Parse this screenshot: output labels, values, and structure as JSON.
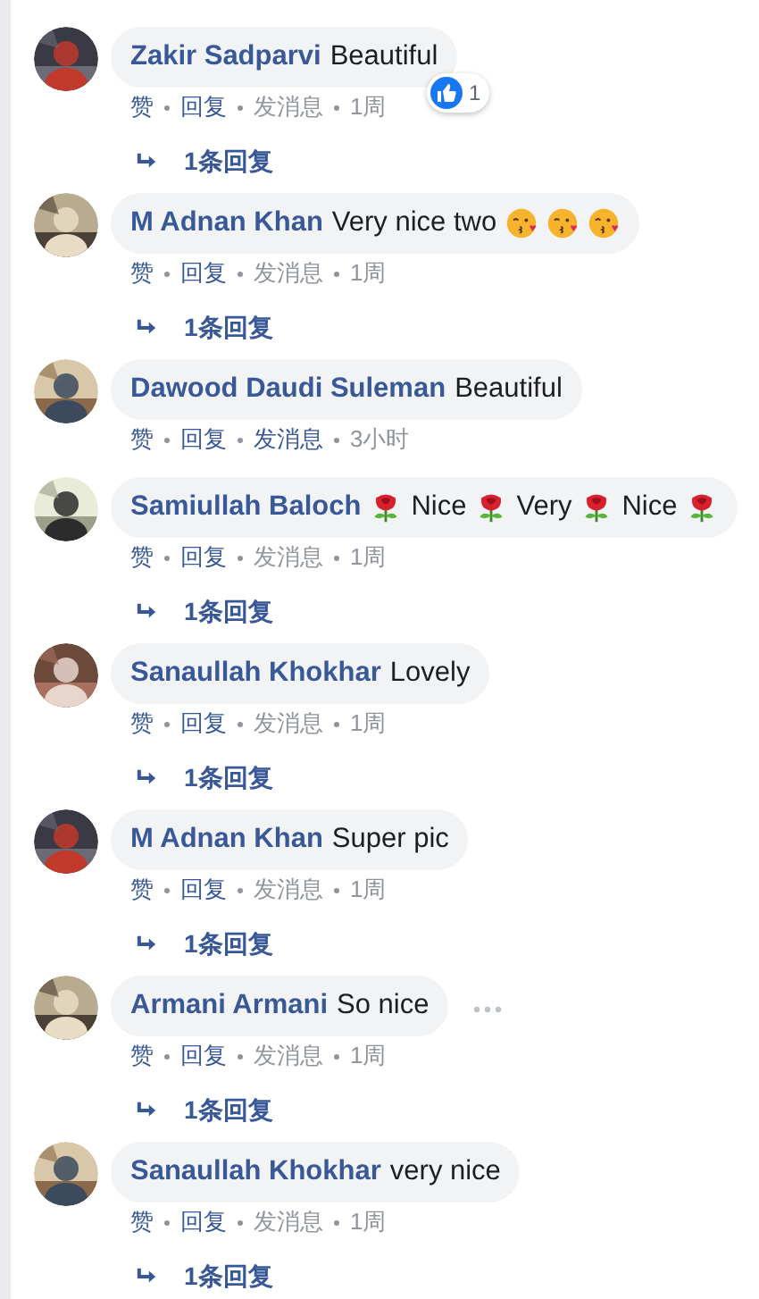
{
  "comments": [
    {
      "avatar": {
        "kind": "picture"
      },
      "author": "Zakir Sadparvi",
      "parts": [
        {
          "kind": "text",
          "text": "Beautiful"
        }
      ],
      "reaction": {
        "count": "1"
      },
      "more_button": false,
      "actions": [
        {
          "label": "赞",
          "kind": "link"
        },
        {
          "label": "回复",
          "kind": "link"
        },
        {
          "label": "发消息",
          "kind": "info"
        },
        {
          "label": "1周",
          "kind": "info"
        }
      ],
      "replies": "1条回复"
    },
    {
      "avatar": {
        "kind": "picture"
      },
      "author": "M Adnan Khan",
      "parts": [
        {
          "kind": "text",
          "text": "Very nice two"
        },
        {
          "kind": "kiss"
        },
        {
          "kind": "kiss"
        },
        {
          "kind": "kiss"
        }
      ],
      "more_button": false,
      "actions": [
        {
          "label": "赞",
          "kind": "link"
        },
        {
          "label": "回复",
          "kind": "link"
        },
        {
          "label": "发消息",
          "kind": "info"
        },
        {
          "label": "1周",
          "kind": "info"
        }
      ],
      "replies": "1条回复"
    },
    {
      "avatar": {
        "kind": "picture"
      },
      "author": "Dawood Daudi Suleman",
      "parts": [
        {
          "kind": "text",
          "text": "Beautiful"
        }
      ],
      "more_button": false,
      "actions": [
        {
          "label": "赞",
          "kind": "link"
        },
        {
          "label": "回复",
          "kind": "link"
        },
        {
          "label": "发消息",
          "kind": "link"
        },
        {
          "label": "3小时",
          "kind": "info"
        }
      ]
    },
    {
      "avatar": {
        "kind": "picture"
      },
      "author": "Samiullah Baloch",
      "parts": [
        {
          "kind": "rose"
        },
        {
          "kind": "text",
          "text": "Nice"
        },
        {
          "kind": "rose"
        },
        {
          "kind": "text",
          "text": "Very"
        },
        {
          "kind": "rose"
        },
        {
          "kind": "text",
          "text": "Nice"
        },
        {
          "kind": "rose"
        }
      ],
      "more_button": false,
      "actions": [
        {
          "label": "赞",
          "kind": "link"
        },
        {
          "label": "回复",
          "kind": "link"
        },
        {
          "label": "发消息",
          "kind": "info"
        },
        {
          "label": "1周",
          "kind": "info"
        }
      ],
      "replies": "1条回复"
    },
    {
      "avatar": {
        "kind": "picture"
      },
      "author": "Sanaullah Khokhar",
      "parts": [
        {
          "kind": "text",
          "text": "Lovely"
        }
      ],
      "more_button": false,
      "actions": [
        {
          "label": "赞",
          "kind": "link"
        },
        {
          "label": "回复",
          "kind": "link"
        },
        {
          "label": "发消息",
          "kind": "info"
        },
        {
          "label": "1周",
          "kind": "info"
        }
      ],
      "replies": "1条回复"
    },
    {
      "avatar": {
        "kind": "picture"
      },
      "author": "M Adnan Khan",
      "parts": [
        {
          "kind": "text",
          "text": "Super pic"
        }
      ],
      "more_button": false,
      "actions": [
        {
          "label": "赞",
          "kind": "link"
        },
        {
          "label": "回复",
          "kind": "link"
        },
        {
          "label": "发消息",
          "kind": "info"
        },
        {
          "label": "1周",
          "kind": "info"
        }
      ],
      "replies": "1条回复"
    },
    {
      "avatar": {
        "kind": "picture"
      },
      "author": "Armani Armani",
      "parts": [
        {
          "kind": "text",
          "text": "So nice"
        }
      ],
      "more_button": true,
      "actions": [
        {
          "label": "赞",
          "kind": "link"
        },
        {
          "label": "回复",
          "kind": "link"
        },
        {
          "label": "发消息",
          "kind": "info"
        },
        {
          "label": "1周",
          "kind": "info"
        }
      ],
      "replies": "1条回复"
    },
    {
      "avatar": {
        "kind": "picture"
      },
      "author": "Sanaullah Khokhar",
      "parts": [
        {
          "kind": "text",
          "text": "very nice"
        }
      ],
      "more_button": false,
      "actions": [
        {
          "label": "赞",
          "kind": "link"
        },
        {
          "label": "回复",
          "kind": "link"
        },
        {
          "label": "发消息",
          "kind": "info"
        },
        {
          "label": "1周",
          "kind": "info"
        }
      ],
      "replies": "1条回复"
    }
  ]
}
